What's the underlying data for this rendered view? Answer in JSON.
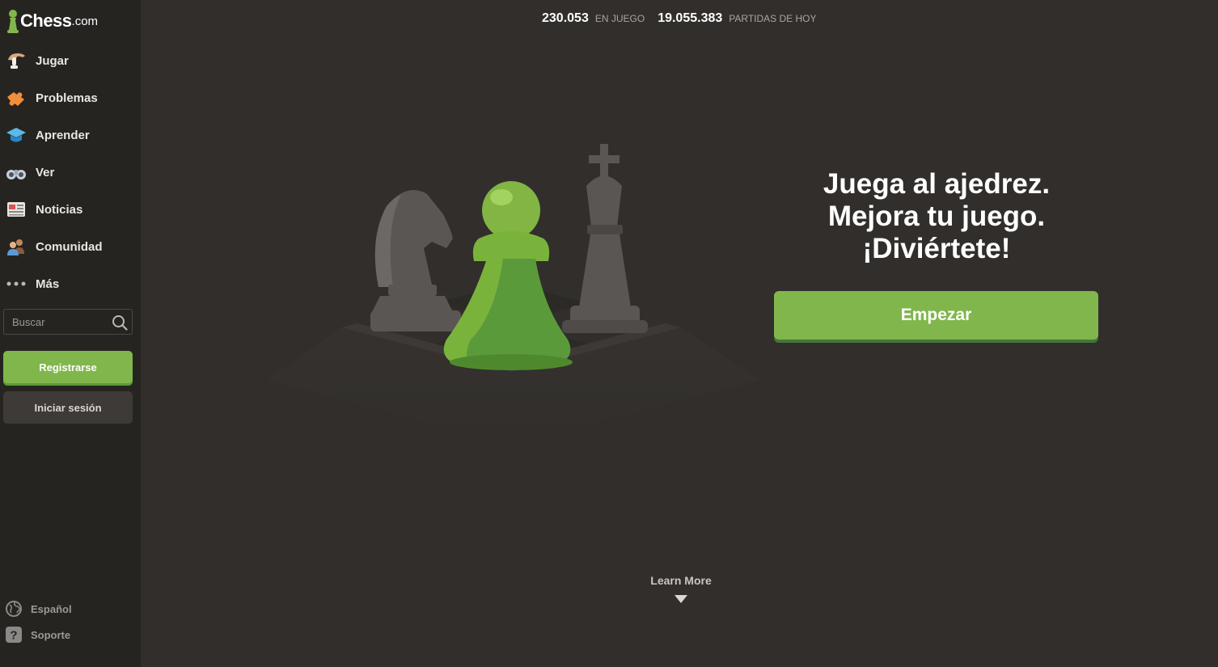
{
  "sidebar": {
    "logo": {
      "main": "Chess",
      "suffix": ".com"
    },
    "nav": [
      {
        "label": "Jugar",
        "icon": "hand-playing-icon"
      },
      {
        "label": "Problemas",
        "icon": "puzzle-icon"
      },
      {
        "label": "Aprender",
        "icon": "graduation-cap-icon"
      },
      {
        "label": "Ver",
        "icon": "binoculars-icon"
      },
      {
        "label": "Noticias",
        "icon": "newspaper-icon"
      },
      {
        "label": "Comunidad",
        "icon": "people-icon"
      },
      {
        "label": "Más",
        "icon": "more-dots-icon"
      }
    ],
    "search": {
      "placeholder": "Buscar"
    },
    "register_label": "Registrarse",
    "login_label": "Iniciar sesión",
    "footer": {
      "language": "Español",
      "support": "Soporte"
    }
  },
  "stats": {
    "playing_count": "230.053",
    "playing_label": "EN JUEGO",
    "games_count": "19.055.383",
    "games_label": "PARTIDAS DE HOY"
  },
  "hero": {
    "headline": [
      "Juega al ajedrez.",
      "Mejora tu juego.",
      "¡Diviértete!"
    ],
    "cta_label": "Empezar",
    "learn_more": "Learn More"
  },
  "colors": {
    "background": "#312e2b",
    "sidebar": "#262421",
    "accent_green": "#81b64c",
    "secondary_button": "#3d3a37"
  }
}
